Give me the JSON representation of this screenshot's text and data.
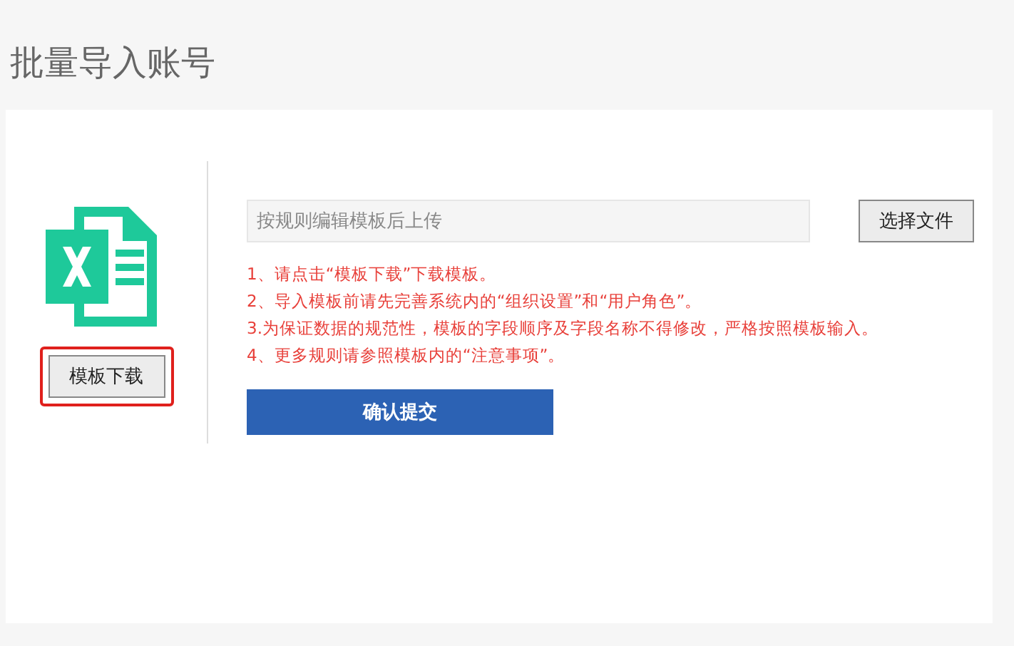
{
  "page": {
    "title": "批量导入账号"
  },
  "template": {
    "download_button": "模板下载",
    "highlighted": true
  },
  "upload": {
    "placeholder": "按规则编辑模板后上传",
    "choose_button": "选择文件"
  },
  "rules": [
    "1、请点击“模板下载”下载模板。",
    "2、导入模板前请先完善系统内的“组织设置”和“用户角色”。",
    "3.为保证数据的规范性，模板的字段顺序及字段名称不得修改，严格按照模板输入。",
    "4、更多规则请参照模板内的“注意事项”。"
  ],
  "submit_button": "确认提交"
}
